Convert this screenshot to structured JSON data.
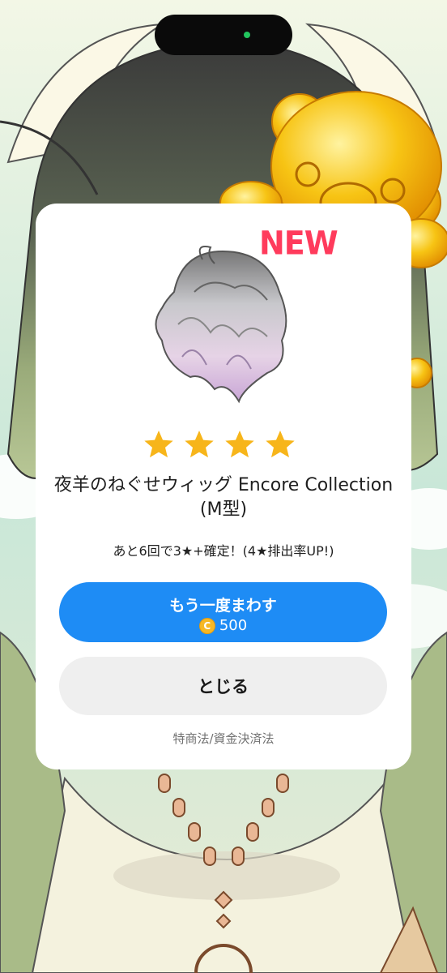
{
  "badge": {
    "new": "NEW"
  },
  "item": {
    "name": "夜羊のねぐせウィッグ Encore Collection (M型)",
    "stars": 4,
    "image_icon": "wig-icon"
  },
  "gacha": {
    "note": "あと6回で3★+確定！(4★排出率UP!)"
  },
  "buttons": {
    "spin_again": "もう一度まわす",
    "cost": "500",
    "coin_symbol": "C",
    "close": "とじる"
  },
  "footer": {
    "legal": "特商法/資金決済法"
  },
  "colors": {
    "primary": "#1e8cf5",
    "new_badge": "#ff3b5c",
    "star": "#f7b51a"
  }
}
